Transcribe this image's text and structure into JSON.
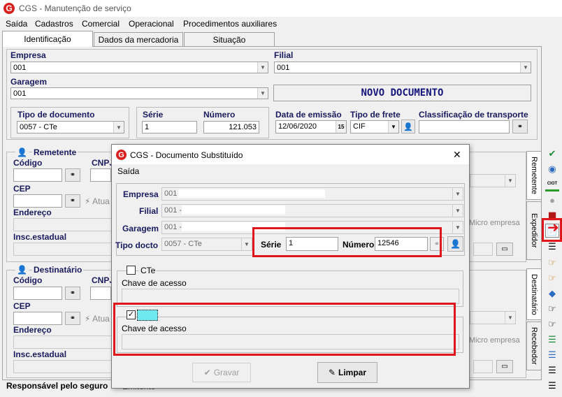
{
  "app": {
    "title": "CGS - Manutenção de serviço",
    "logo": "G"
  },
  "menu": [
    "Saída",
    "Cadastros",
    "Comercial",
    "Operacional",
    "Procedimentos auxiliares"
  ],
  "tabs": [
    "Identificação",
    "Dados da mercadoria",
    "Situação"
  ],
  "main": {
    "empresa_label": "Empresa",
    "empresa_value": "001",
    "filial_label": "Filial",
    "filial_value": "001",
    "garagem_label": "Garagem",
    "garagem_value": "001",
    "banner": "NOVO DOCUMENTO",
    "tipo_doc_label": "Tipo de documento",
    "tipo_doc_value": "0057 - CTe",
    "serie_label": "Série",
    "serie_value": "1",
    "numero_label": "Número",
    "numero_value": "121.053",
    "emissao_label": "Data de emissão",
    "emissao_value": "12/06/2020",
    "frete_label": "Tipo de frete",
    "frete_value": "CIF",
    "classif_label": "Classificação de transporte",
    "remetente_title": "Remetente",
    "destinatario_title": "Destinatário",
    "codigo_label": "Código",
    "cnpj_label": "CNPJ",
    "cep_label": "CEP",
    "endereco_label": "Endereço",
    "insc_label": "Insc.estadual",
    "atua_label": "Atua",
    "micro_label": "Micro empresa",
    "responsavel_label": "Responsável pelo seguro",
    "responsavel_value": "Emitente"
  },
  "side_tabs": [
    "Remetente",
    "Expedidor",
    "Destinatário",
    "Recebedor"
  ],
  "dialog": {
    "title": "CGS - Documento Substituído",
    "close": "✕",
    "menu": "Saída",
    "empresa_label": "Empresa",
    "empresa_value": "001",
    "filial_label": "Filial",
    "filial_value": "001 -",
    "garagem_label": "Garagem",
    "garagem_value": "001 -",
    "tipo_label": "Tipo docto",
    "tipo_value": "0057 - CTe",
    "serie_label": "Série",
    "serie_value": "1",
    "numero_label": "Número",
    "numero_value": "12546",
    "cte_label": "CTe",
    "chave1_label": "Chave de acesso",
    "chave2_label": "Chave de acesso",
    "gravar": "Gravar",
    "limpar": "Limpar"
  },
  "icons": {
    "check": "✔",
    "globe": "◉",
    "ciot": "CIOT",
    "circle": "●",
    "truck": "▆",
    "doc": "📄",
    "list": "☰",
    "hand": "☞",
    "dots": "◆",
    "arrow": "➜"
  }
}
